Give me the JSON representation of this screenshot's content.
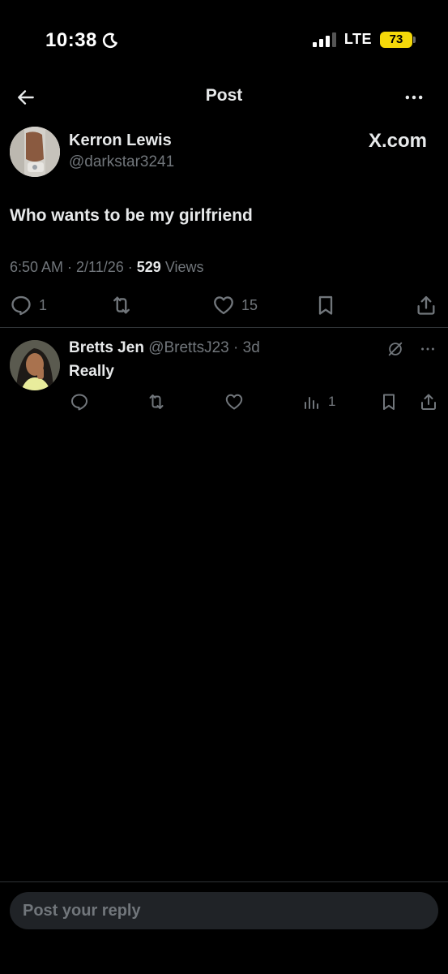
{
  "status_bar": {
    "time": "10:38",
    "network": "LTE",
    "battery": "73",
    "battery_color": "#f5d90a"
  },
  "header": {
    "title": "Post",
    "back_icon": "arrow-left-icon",
    "more_icon": "more-horizontal-icon"
  },
  "post": {
    "author_name": "Kerron Lewis",
    "author_handle": "@darkstar3241",
    "source_label": "X.com",
    "text": "Who wants to be my girlfriend",
    "meta_prefix": "6:50 AM · 2/11/26 · ",
    "views_count": "529",
    "views_label": " Views",
    "replies_count": "1",
    "likes_count": "15"
  },
  "reply": {
    "author_name": "Bretts Jen",
    "author_handle": "@BrettsJ23",
    "age": "· 3d",
    "text": "Really",
    "views_count": "1"
  },
  "composer": {
    "placeholder": "Post your reply"
  },
  "colors": {
    "background": "#000000",
    "text_primary": "#e7e9ea",
    "text_secondary": "#71767b",
    "divider": "#2f3336",
    "input_bg": "#202327"
  }
}
